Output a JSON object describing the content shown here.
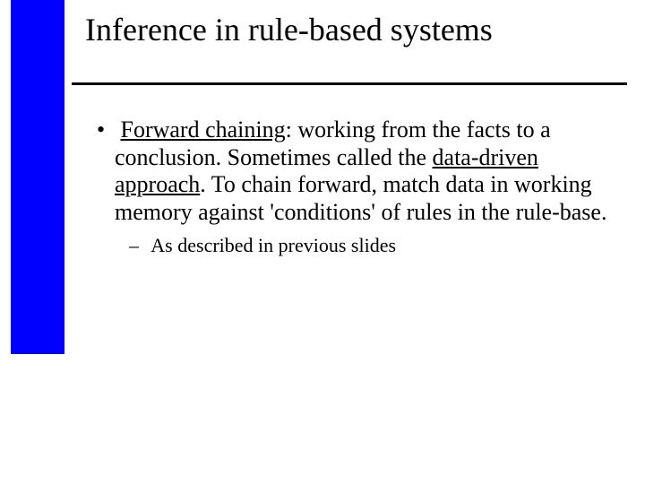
{
  "title": "Inference in rule-based systems",
  "bullet1": {
    "seg1": "Forward chaining",
    "seg2": ": working from the facts to a conclusion. Sometimes called the ",
    "seg3": "data-driven approach",
    "seg4": ". To chain forward, match data in working memory against 'conditions' of rules in the rule-base."
  },
  "sub1": "As described in previous slides"
}
